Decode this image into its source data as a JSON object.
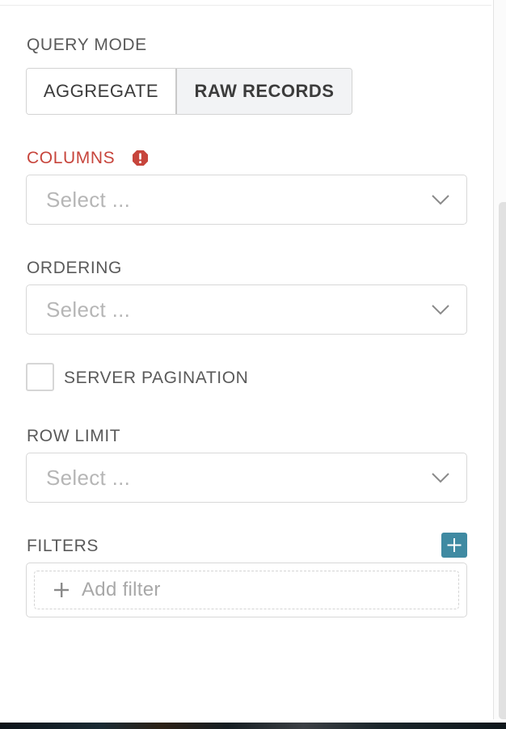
{
  "query_mode": {
    "label": "QUERY MODE",
    "options": [
      "AGGREGATE",
      "RAW RECORDS"
    ],
    "selected": "RAW RECORDS"
  },
  "columns": {
    "label": "COLUMNS",
    "placeholder": "Select ...",
    "has_error": true
  },
  "ordering": {
    "label": "ORDERING",
    "placeholder": "Select ..."
  },
  "server_pagination": {
    "label": "SERVER PAGINATION",
    "checked": false
  },
  "row_limit": {
    "label": "ROW LIMIT",
    "placeholder": "Select ..."
  },
  "filters": {
    "label": "FILTERS",
    "add_filter_text": "Add filter"
  },
  "colors": {
    "error": "#c7453c",
    "accent": "#3f8aa2",
    "label": "#5a5a5a",
    "placeholder": "#b6b6b6"
  },
  "icons": {
    "error": "exclamation-circle-icon",
    "dropdown": "chevron-down-icon",
    "add": "plus-icon"
  }
}
